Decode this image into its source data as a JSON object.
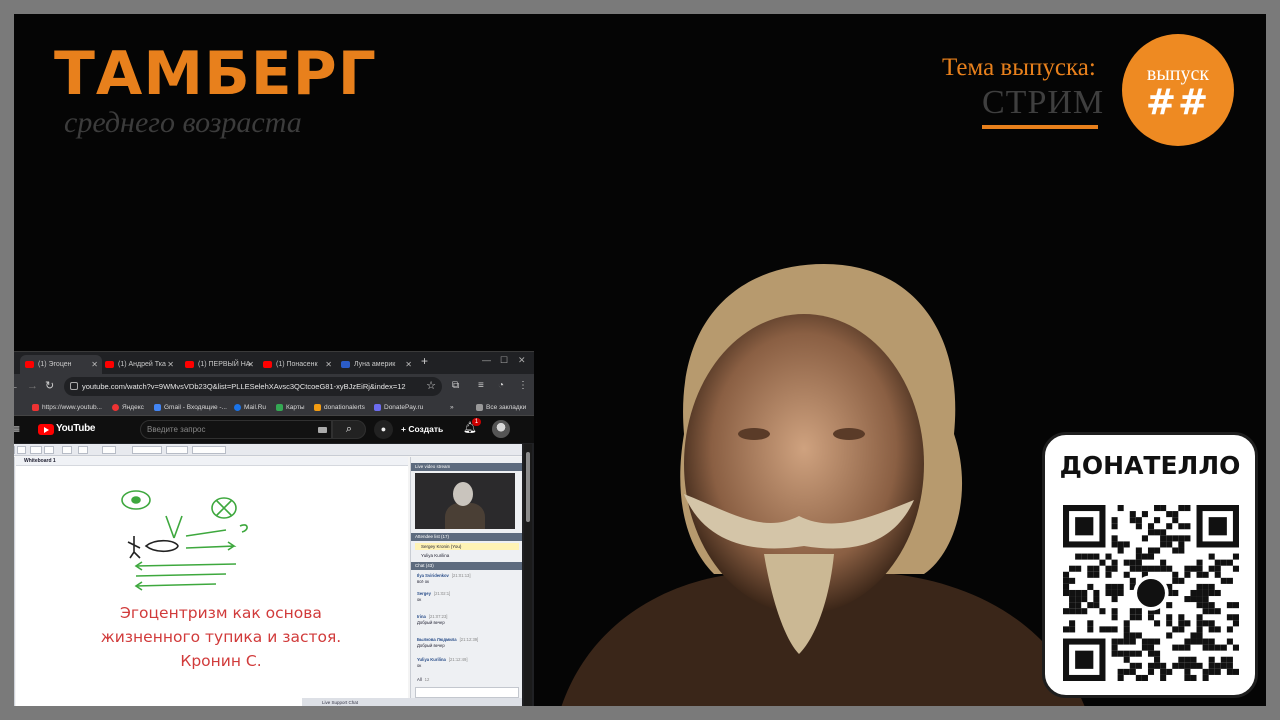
{
  "overlay": {
    "logo_title": "ТАМБЕРГ",
    "logo_subtitle": "среднего возраста",
    "episode_label": "Тема выпуска:",
    "episode_topic": "СТРИМ",
    "badge_label": "выпуск",
    "badge_number": "##",
    "donate_title": "ДОНАТЕЛЛО",
    "accent_color": "#e8801c"
  },
  "browser": {
    "tabs": [
      {
        "label": "(1) Эгоцен"
      },
      {
        "label": "(1) Андрей Тка"
      },
      {
        "label": "(1) ПЕРВЫЙ НА"
      },
      {
        "label": "(1) Понасенк"
      },
      {
        "label": "Луна америк"
      }
    ],
    "url": "youtube.com/watch?v=9WMvsVDb23Q&list=PLLESelehXAvsc3QCtcoeG81-xyBJzEiRj&index=12",
    "bookmarks": [
      {
        "label": "https://www.youtub..."
      },
      {
        "label": "Яндекс"
      },
      {
        "label": "Gmail - Входящие -..."
      },
      {
        "label": "Mail.Ru"
      },
      {
        "label": "Карты"
      },
      {
        "label": "donationalerts"
      },
      {
        "label": "DonatePay.ru"
      },
      {
        "label": "Все закладки"
      }
    ],
    "icons": [
      "back-icon",
      "forward-icon",
      "reload-icon",
      "star-icon",
      "extensions-icon",
      "menu-icon"
    ]
  },
  "youtube": {
    "logo": "YouTube",
    "search_placeholder": "Введите запрос",
    "create_label": "Создать",
    "notifications_count": "1"
  },
  "whiteboard": {
    "tab_title": "Whiteboard 1",
    "caption_lines": [
      "Эгоцентризм как основа",
      "жизненного тупика и застоя.",
      "Кронин С."
    ],
    "caption_color": "#d13b3b",
    "side_panels": {
      "video_header": "Live video stream",
      "attendees_header": "Attendee list (17)",
      "chat_header": "Chat (43)"
    },
    "attendees": [
      "Sergey Kronin (You)",
      "Yuliya Kurilina"
    ],
    "chat": [
      {
        "name": "Ilya Sviridenkov",
        "time": "[21:01:13]",
        "text": "всё ок"
      },
      {
        "name": "Sergey",
        "time": "[21:02:1]",
        "text": "ок"
      },
      {
        "name": "Irina",
        "time": "[21:07:23]",
        "text": "Добрый вечер"
      },
      {
        "name": "Былкова Людмила",
        "time": "[21:12:39]",
        "text": "Добрый вечер"
      },
      {
        "name": "Yuliya Kurilina",
        "time": "[21:12:49]",
        "text": "ок"
      }
    ],
    "chat_recipient": "All",
    "font_size": "12",
    "status": "Live Support Chat"
  }
}
